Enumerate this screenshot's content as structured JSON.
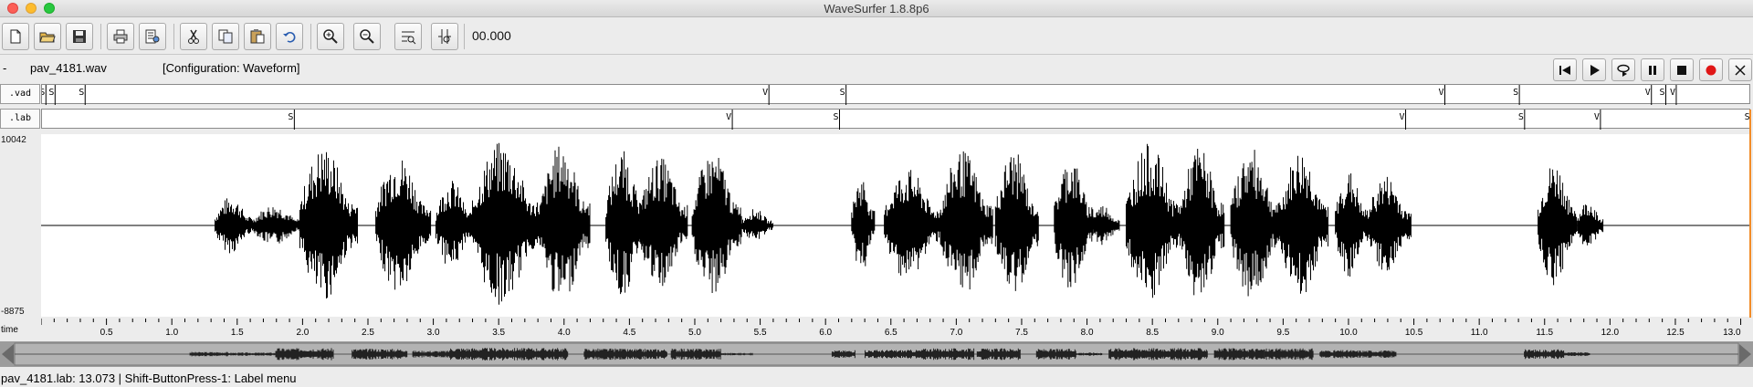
{
  "window": {
    "title": "WaveSurfer 1.8.8p6"
  },
  "toolbar": {
    "buttons": [
      {
        "name": "new-file-icon"
      },
      {
        "name": "open-folder-icon"
      },
      {
        "name": "save-icon"
      },
      {
        "name": "print-icon"
      },
      {
        "name": "properties-icon"
      },
      {
        "name": "cut-icon"
      },
      {
        "name": "copy-icon"
      },
      {
        "name": "paste-icon"
      },
      {
        "name": "undo-icon"
      },
      {
        "name": "zoom-in-icon"
      },
      {
        "name": "zoom-out-icon"
      },
      {
        "name": "zoom-full-icon"
      },
      {
        "name": "zoom-selection-icon"
      }
    ],
    "time_value": "00.000"
  },
  "info": {
    "dash": "-",
    "filename": "pav_4181.wav",
    "configuration": "[Configuration: Waveform]"
  },
  "playback": {
    "buttons": [
      "skip-back-icon",
      "play-icon",
      "play-loop-icon",
      "pause-icon",
      "stop-icon",
      "record-icon",
      "close-icon"
    ]
  },
  "tiers": {
    "vad": {
      "label": ".vad",
      "segments": [
        {
          "t": 0.03,
          "l": "S"
        },
        {
          "t": 0.1,
          "l": "S"
        },
        {
          "t": 0.33,
          "l": "S"
        },
        {
          "t": 5.56,
          "l": "V"
        },
        {
          "t": 6.15,
          "l": "S"
        },
        {
          "t": 10.73,
          "l": "V"
        },
        {
          "t": 11.3,
          "l": "S"
        },
        {
          "t": 12.31,
          "l": "V"
        },
        {
          "t": 12.42,
          "l": "S"
        },
        {
          "t": 12.5,
          "l": "V"
        }
      ]
    },
    "lab": {
      "label": ".lab",
      "segments": [
        {
          "t": 1.93,
          "l": "S"
        },
        {
          "t": 5.28,
          "l": "V"
        },
        {
          "t": 6.1,
          "l": "S"
        },
        {
          "t": 10.43,
          "l": "V"
        },
        {
          "t": 11.34,
          "l": "S"
        },
        {
          "t": 11.92,
          "l": "V"
        },
        {
          "t": 13.07,
          "l": "S"
        }
      ]
    }
  },
  "waveform": {
    "ymax_label": "10042",
    "ymin_label": "-8875",
    "duration": 13.073,
    "bursts": [
      [
        1.33,
        1.62,
        0.35
      ],
      [
        1.62,
        2.0,
        0.25
      ],
      [
        1.98,
        2.42,
        0.95
      ],
      [
        2.56,
        2.98,
        0.85
      ],
      [
        3.02,
        3.3,
        0.55
      ],
      [
        3.3,
        3.82,
        1.0
      ],
      [
        3.82,
        4.2,
        0.98
      ],
      [
        4.32,
        4.62,
        0.9
      ],
      [
        4.58,
        4.95,
        0.82
      ],
      [
        4.98,
        5.36,
        0.88
      ],
      [
        5.36,
        5.6,
        0.2
      ],
      [
        6.2,
        6.38,
        0.6
      ],
      [
        6.45,
        6.88,
        0.68
      ],
      [
        6.88,
        7.28,
        0.9
      ],
      [
        7.3,
        7.63,
        0.9
      ],
      [
        7.75,
        8.05,
        0.82
      ],
      [
        8.03,
        8.25,
        0.25
      ],
      [
        8.3,
        8.72,
        0.98
      ],
      [
        8.72,
        9.05,
        0.95
      ],
      [
        9.1,
        9.48,
        0.92
      ],
      [
        9.48,
        9.85,
        0.9
      ],
      [
        9.9,
        10.15,
        0.65
      ],
      [
        10.15,
        10.48,
        0.6
      ],
      [
        11.45,
        11.75,
        0.75
      ],
      [
        11.75,
        11.95,
        0.3
      ]
    ]
  },
  "time_axis": {
    "label": "time",
    "ticks": [
      "0.5",
      "1.0",
      "1.5",
      "2.0",
      "2.5",
      "3.0",
      "3.5",
      "4.0",
      "4.5",
      "5.0",
      "5.5",
      "6.0",
      "6.5",
      "7.0",
      "7.5",
      "8.0",
      "8.5",
      "9.0",
      "9.5",
      "10.0",
      "10.5",
      "11.0",
      "11.5",
      "12.0",
      "12.5",
      "13.0"
    ]
  },
  "status": {
    "text": "pav_4181.lab: 13.073 | Shift-ButtonPress-1: Label menu"
  }
}
